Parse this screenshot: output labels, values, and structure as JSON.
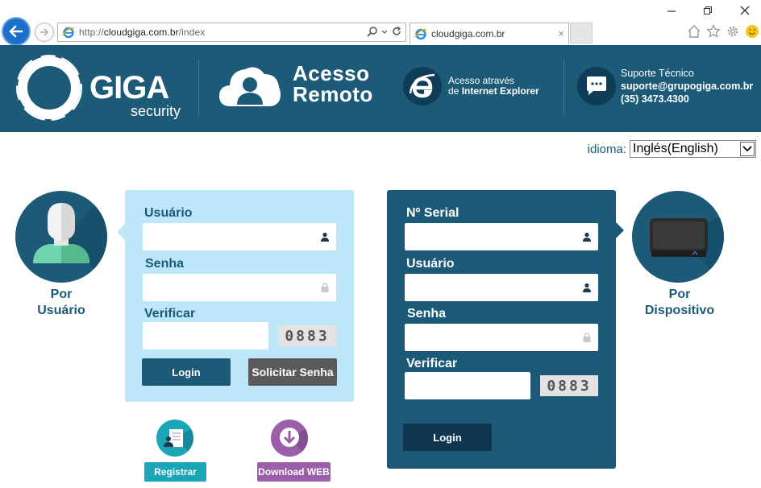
{
  "browser": {
    "url_prefix": "http://",
    "url_host": "cloudgiga.com.br",
    "url_path": "/index",
    "tab_title": "cloudgiga.com.br",
    "tab_close": "×"
  },
  "header": {
    "logo_text": "GIGA",
    "logo_sub": "security",
    "remote_line1": "Acesso",
    "remote_line2": "Remoto",
    "ie_line1": "Acesso através",
    "ie_line2_prefix": "de ",
    "ie_line2_bold": "Internet Explorer",
    "support_title": "Suporte Técnico",
    "support_email": "suporte@grupogiga.com.br",
    "support_phone": "(35) 3473.4300"
  },
  "language": {
    "label": "idioma:",
    "selected": "Inglés(English)"
  },
  "user_side": {
    "label_line1": "Por",
    "label_line2": "Usuário",
    "form": {
      "user_label": "Usuário",
      "password_label": "Senha",
      "verify_label": "Verificar",
      "captcha": "0883",
      "login_label": "Login",
      "request_label": "Solicitar Senha"
    }
  },
  "device_side": {
    "label_line1": "Por",
    "label_line2": "Dispositivo",
    "form": {
      "serial_label": "Nº Serial",
      "user_label": "Usuário",
      "password_label": "Senha",
      "verify_label": "Verificar",
      "captcha": "0883",
      "login_label": "Login"
    }
  },
  "actions": {
    "register_label": "Registrar",
    "download_label": "Download WEB"
  },
  "colors": {
    "brand_dark": "#1c5a78",
    "panel_light": "#bde6f9",
    "register_teal": "#1aa6b7",
    "download_purple": "#9b5ea8"
  }
}
